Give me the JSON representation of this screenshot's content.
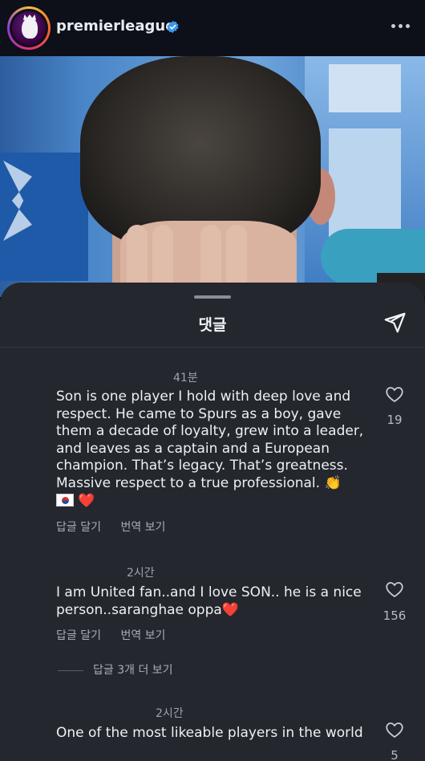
{
  "header": {
    "username": "premierleague",
    "verified_icon": "verified-badge-icon",
    "more_icon": "more-horizontal-icon"
  },
  "sheet": {
    "title": "댓글",
    "send_icon": "share-send-icon"
  },
  "comments": [
    {
      "time": "41분",
      "text": "Son is one player I hold with deep love and respect. He came to Spurs as a boy, gave them a decade of loyalty, grew into a leader, and leaves as a captain and a European champion. That’s legacy. That’s greatness. Massive respect to a true professional. 👏",
      "emoji_line": "🇰🇷 ❤️",
      "reply_label": "답글 달기",
      "translate_label": "번역 보기",
      "likes": "19"
    },
    {
      "time": "2시간",
      "text": "I am United fan..and I love SON.. he is a nice person..saranghae oppa❤️",
      "reply_label": "답글 달기",
      "translate_label": "번역 보기",
      "likes": "156",
      "view_replies": "답글 3개 더 보기"
    },
    {
      "time": "2시간",
      "text": "One of the most likeable players in the world",
      "likes": "5"
    }
  ],
  "colors": {
    "sheet_bg": "#24272d",
    "topbar_bg": "#0d1018",
    "verified": "#3897f0"
  }
}
